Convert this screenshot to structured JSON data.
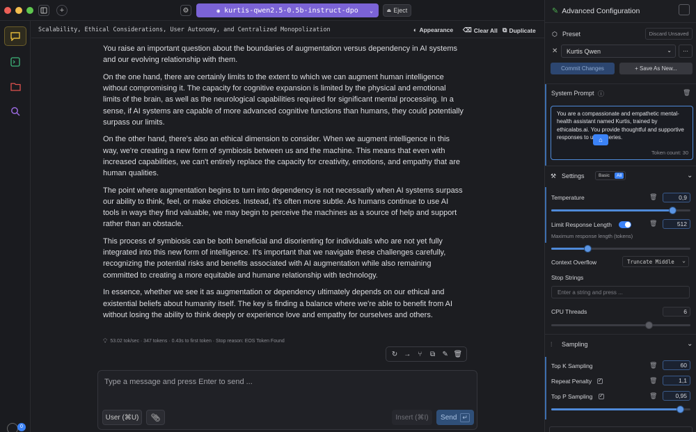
{
  "window": {
    "traffic_lights": [
      "#ec5f57",
      "#f3be4f",
      "#5fc74f"
    ]
  },
  "topbar": {
    "model_name": "kurtis-qwen2.5-0.5b-instruct-dpo",
    "eject_label": "Eject"
  },
  "conversation": {
    "title": "Scalability, Ethical Considerations, User Autonomy, and Centralized Monopolization",
    "appearance_label": "Appearance",
    "clear_all_label": "Clear All",
    "duplicate_label": "Duplicate"
  },
  "message": {
    "paragraphs": [
      "You raise an important question about the boundaries of augmentation versus dependency in AI systems and our evolving relationship with them.",
      "On the one hand, there are certainly limits to the extent to which we can augment human intelligence without compromising it. The capacity for cognitive expansion is limited by the physical and emotional limits of the brain, as well as the neurological capabilities required for significant mental processing. In a sense, if AI systems are capable of more advanced cognitive functions than humans, they could potentially surpass our limits.",
      "On the other hand, there's also an ethical dimension to consider. When we augment intelligence in this way, we're creating a new form of symbiosis between us and the machine. This means that even with increased capabilities, we can't entirely replace the capacity for creativity, emotions, and empathy that are human qualities.",
      "The point where augmentation begins to turn into dependency is not necessarily when AI systems surpass our ability to think, feel, or make choices. Instead, it's often more subtle. As humans continue to use AI tools in ways they find valuable, we may begin to perceive the machines as a source of help and support rather than an obstacle.",
      "This process of symbiosis can be both beneficial and disorienting for individuals who are not yet fully integrated into this new form of intelligence. It's important that we navigate these challenges carefully, recognizing the potential risks and benefits associated with AI augmentation while also remaining committed to creating a more equitable and humane relationship with technology.",
      "In essence, whether we see it as augmentation or dependency ultimately depends on our ethical and existential beliefs about humanity itself. The key is finding a balance where we're able to benefit from AI without losing the ability to think deeply or experience love and empathy for ourselves and others."
    ],
    "stats": "53.02 tok/sec · 347 tokens · 0.43s to first token · Stop reason: EOS Token Found"
  },
  "composer": {
    "placeholder": "Type a message and press Enter to send ...",
    "user_label": "User (⌘U)",
    "insert_label": "Insert (⌘I)",
    "send_label": "Send"
  },
  "rail": {
    "badge": "0"
  },
  "config": {
    "title": "Advanced Configuration",
    "preset_label": "Preset",
    "discard_label": "Discard Unsaved",
    "preset_value": "Kurtis Qwen",
    "commit_label": "Commit Changes",
    "save_as_label": "+ Save As New...",
    "system_prompt_label": "System Prompt",
    "system_prompt_text": "You are a compassionate and empathetic mental-health assistant named Kurtis, trained by ethicalabs.ai. You provide thoughtful and supportive responses to user queries.",
    "token_count": "Token count: 30",
    "settings_label": "Settings",
    "basic_label": "Basic",
    "all_label": "All",
    "temperature_label": "Temperature",
    "temperature_value": "0,9",
    "temperature_level": 0.9,
    "limit_label": "Limit Response Length",
    "limit_value": "512",
    "max_tokens_label": "Maximum response length (tokens)",
    "context_overflow_label": "Context Overflow",
    "context_overflow_value": "Truncate Middle",
    "stop_strings_label": "Stop Strings",
    "stop_strings_placeholder": "Enter a string and press ...",
    "cpu_threads_label": "CPU Threads",
    "cpu_threads_value": "6",
    "sampling_label": "Sampling",
    "topk_label": "Top K Sampling",
    "topk_value": "60",
    "repeat_label": "Repeat Penalty",
    "repeat_value": "1,1",
    "topp_label": "Top P Sampling",
    "topp_value": "0,95",
    "topp_level": 0.95
  }
}
